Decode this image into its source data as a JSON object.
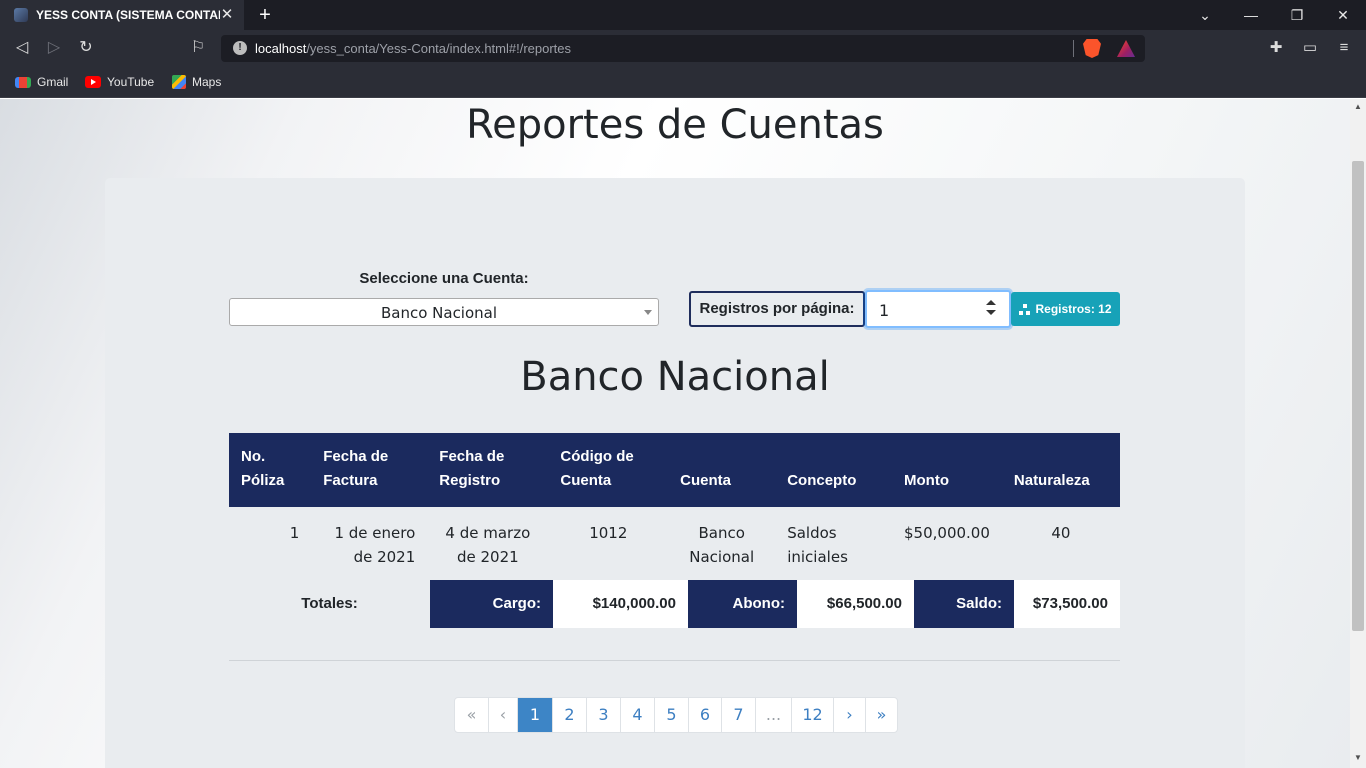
{
  "browser": {
    "tab_title": "YESS CONTA (SISTEMA CONTABLE",
    "tab_close": "✕",
    "new_tab": "+",
    "url_host": "localhost",
    "url_path": "/yess_conta/Yess-Conta/index.html#!/reportes",
    "bookmarks": [
      {
        "label": "Gmail"
      },
      {
        "label": "YouTube"
      },
      {
        "label": "Maps"
      }
    ]
  },
  "page": {
    "title": "Reportes de Cuentas",
    "select_label": "Seleccione una Cuenta:",
    "selected_account": "Banco Nacional",
    "per_page_label": "Registros por página:",
    "per_page_value": "1",
    "records_button": "Registros: 12",
    "account_heading": "Banco Nacional"
  },
  "table": {
    "headers": [
      "No. Póliza",
      "Fecha de Factura",
      "Fecha de Registro",
      "Código de Cuenta",
      "Cuenta",
      "Concepto",
      "Monto",
      "Naturaleza"
    ],
    "rows": [
      [
        "1",
        "1 de enero de 2021",
        "4 de marzo de 2021",
        "1012",
        "Banco Nacional",
        "Saldos iniciales",
        "$50,000.00",
        "40"
      ]
    ]
  },
  "totals": {
    "label": "Totales:",
    "cargo_label": "Cargo:",
    "cargo_value": "$140,000.00",
    "abono_label": "Abono:",
    "abono_value": "$66,500.00",
    "saldo_label": "Saldo:",
    "saldo_value": "$73,500.00"
  },
  "pagination": {
    "first": "«",
    "prev": "‹",
    "pages": [
      "1",
      "2",
      "3",
      "4",
      "5",
      "6",
      "7",
      "...",
      "12"
    ],
    "active_page": "1",
    "next": "›",
    "last": "»"
  },
  "colors": {
    "header_navy": "#1b2a5e",
    "accent_teal": "#17a2b8",
    "active_page_blue": "#3d85c6"
  }
}
